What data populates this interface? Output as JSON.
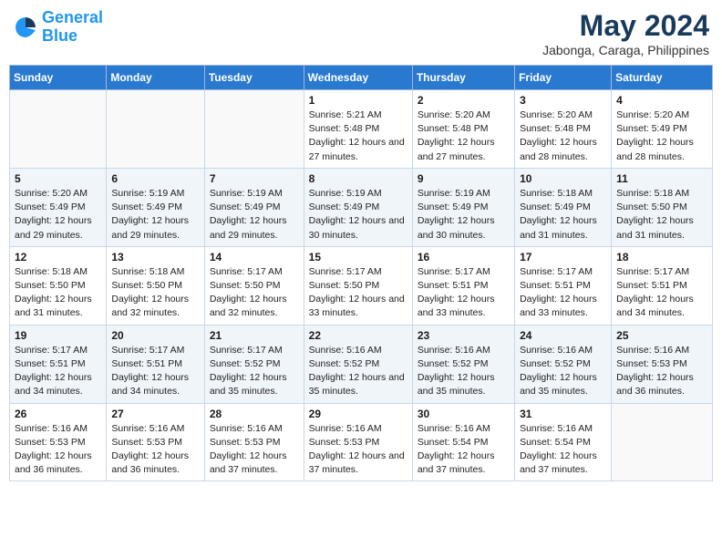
{
  "header": {
    "logo_line1": "General",
    "logo_line2": "Blue",
    "title": "May 2024",
    "subtitle": "Jabonga, Caraga, Philippines"
  },
  "weekdays": [
    "Sunday",
    "Monday",
    "Tuesday",
    "Wednesday",
    "Thursday",
    "Friday",
    "Saturday"
  ],
  "weeks": [
    [
      {
        "day": "",
        "info": ""
      },
      {
        "day": "",
        "info": ""
      },
      {
        "day": "",
        "info": ""
      },
      {
        "day": "1",
        "info": "Sunrise: 5:21 AM\nSunset: 5:48 PM\nDaylight: 12 hours and 27 minutes."
      },
      {
        "day": "2",
        "info": "Sunrise: 5:20 AM\nSunset: 5:48 PM\nDaylight: 12 hours and 27 minutes."
      },
      {
        "day": "3",
        "info": "Sunrise: 5:20 AM\nSunset: 5:48 PM\nDaylight: 12 hours and 28 minutes."
      },
      {
        "day": "4",
        "info": "Sunrise: 5:20 AM\nSunset: 5:49 PM\nDaylight: 12 hours and 28 minutes."
      }
    ],
    [
      {
        "day": "5",
        "info": "Sunrise: 5:20 AM\nSunset: 5:49 PM\nDaylight: 12 hours and 29 minutes."
      },
      {
        "day": "6",
        "info": "Sunrise: 5:19 AM\nSunset: 5:49 PM\nDaylight: 12 hours and 29 minutes."
      },
      {
        "day": "7",
        "info": "Sunrise: 5:19 AM\nSunset: 5:49 PM\nDaylight: 12 hours and 29 minutes."
      },
      {
        "day": "8",
        "info": "Sunrise: 5:19 AM\nSunset: 5:49 PM\nDaylight: 12 hours and 30 minutes."
      },
      {
        "day": "9",
        "info": "Sunrise: 5:19 AM\nSunset: 5:49 PM\nDaylight: 12 hours and 30 minutes."
      },
      {
        "day": "10",
        "info": "Sunrise: 5:18 AM\nSunset: 5:49 PM\nDaylight: 12 hours and 31 minutes."
      },
      {
        "day": "11",
        "info": "Sunrise: 5:18 AM\nSunset: 5:50 PM\nDaylight: 12 hours and 31 minutes."
      }
    ],
    [
      {
        "day": "12",
        "info": "Sunrise: 5:18 AM\nSunset: 5:50 PM\nDaylight: 12 hours and 31 minutes."
      },
      {
        "day": "13",
        "info": "Sunrise: 5:18 AM\nSunset: 5:50 PM\nDaylight: 12 hours and 32 minutes."
      },
      {
        "day": "14",
        "info": "Sunrise: 5:17 AM\nSunset: 5:50 PM\nDaylight: 12 hours and 32 minutes."
      },
      {
        "day": "15",
        "info": "Sunrise: 5:17 AM\nSunset: 5:50 PM\nDaylight: 12 hours and 33 minutes."
      },
      {
        "day": "16",
        "info": "Sunrise: 5:17 AM\nSunset: 5:51 PM\nDaylight: 12 hours and 33 minutes."
      },
      {
        "day": "17",
        "info": "Sunrise: 5:17 AM\nSunset: 5:51 PM\nDaylight: 12 hours and 33 minutes."
      },
      {
        "day": "18",
        "info": "Sunrise: 5:17 AM\nSunset: 5:51 PM\nDaylight: 12 hours and 34 minutes."
      }
    ],
    [
      {
        "day": "19",
        "info": "Sunrise: 5:17 AM\nSunset: 5:51 PM\nDaylight: 12 hours and 34 minutes."
      },
      {
        "day": "20",
        "info": "Sunrise: 5:17 AM\nSunset: 5:51 PM\nDaylight: 12 hours and 34 minutes."
      },
      {
        "day": "21",
        "info": "Sunrise: 5:17 AM\nSunset: 5:52 PM\nDaylight: 12 hours and 35 minutes."
      },
      {
        "day": "22",
        "info": "Sunrise: 5:16 AM\nSunset: 5:52 PM\nDaylight: 12 hours and 35 minutes."
      },
      {
        "day": "23",
        "info": "Sunrise: 5:16 AM\nSunset: 5:52 PM\nDaylight: 12 hours and 35 minutes."
      },
      {
        "day": "24",
        "info": "Sunrise: 5:16 AM\nSunset: 5:52 PM\nDaylight: 12 hours and 35 minutes."
      },
      {
        "day": "25",
        "info": "Sunrise: 5:16 AM\nSunset: 5:53 PM\nDaylight: 12 hours and 36 minutes."
      }
    ],
    [
      {
        "day": "26",
        "info": "Sunrise: 5:16 AM\nSunset: 5:53 PM\nDaylight: 12 hours and 36 minutes."
      },
      {
        "day": "27",
        "info": "Sunrise: 5:16 AM\nSunset: 5:53 PM\nDaylight: 12 hours and 36 minutes."
      },
      {
        "day": "28",
        "info": "Sunrise: 5:16 AM\nSunset: 5:53 PM\nDaylight: 12 hours and 37 minutes."
      },
      {
        "day": "29",
        "info": "Sunrise: 5:16 AM\nSunset: 5:53 PM\nDaylight: 12 hours and 37 minutes."
      },
      {
        "day": "30",
        "info": "Sunrise: 5:16 AM\nSunset: 5:54 PM\nDaylight: 12 hours and 37 minutes."
      },
      {
        "day": "31",
        "info": "Sunrise: 5:16 AM\nSunset: 5:54 PM\nDaylight: 12 hours and 37 minutes."
      },
      {
        "day": "",
        "info": ""
      }
    ]
  ]
}
